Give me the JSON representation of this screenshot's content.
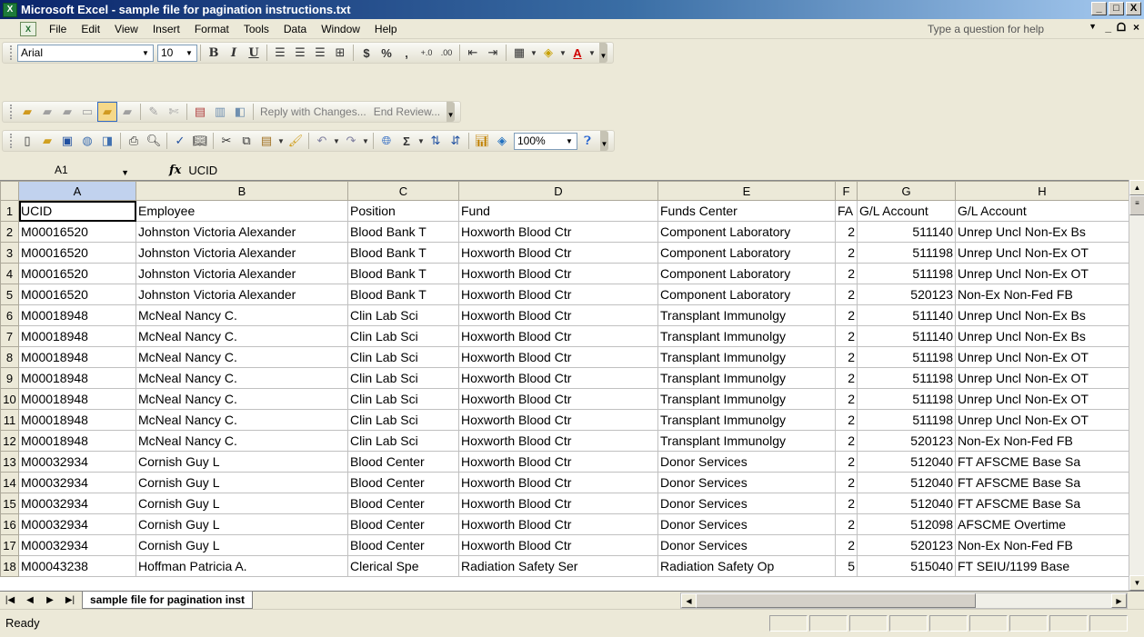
{
  "window": {
    "title": "Microsoft Excel - sample file for pagination instructions.txt",
    "min": "_",
    "max": "□",
    "close": "X",
    "app_icon": "X"
  },
  "menu": {
    "doc_icon": "X",
    "items": [
      "File",
      "Edit",
      "View",
      "Insert",
      "Format",
      "Tools",
      "Data",
      "Window",
      "Help"
    ],
    "help_placeholder": "Type a question for help",
    "doc_min": "_",
    "doc_restore": "ᗝ",
    "doc_close": "×"
  },
  "formatting_toolbar": {
    "font": "Arial",
    "size": "10",
    "bold": "B",
    "italic": "I",
    "underline": "U",
    "currency": "$",
    "percent": "%",
    "comma": ",",
    "inc_decimal": "+.0",
    "dec_decimal": ".00",
    "font_color": "A"
  },
  "reviewing_toolbar": {
    "reply": "Reply with Changes...",
    "end_review": "End Review..."
  },
  "standard_toolbar": {
    "autosum": "Σ",
    "zoom": "100%"
  },
  "formula_bar": {
    "name_box": "A1",
    "fx": "fx",
    "value": "UCID"
  },
  "sheet": {
    "columns": [
      "A",
      "B",
      "C",
      "D",
      "E",
      "F",
      "G",
      "H"
    ],
    "rows": [
      [
        "UCID",
        "Employee",
        "Position",
        "Fund",
        "Funds Center",
        "FA",
        "G/L Account",
        "G/L Account"
      ],
      [
        "M00016520",
        "Johnston Victoria Alexander",
        "Blood Bank T",
        "Hoxworth Blood Ctr",
        "Component Laboratory",
        "2",
        "511140",
        "Unrep Uncl Non-Ex Bs"
      ],
      [
        "M00016520",
        "Johnston Victoria Alexander",
        "Blood Bank T",
        "Hoxworth Blood Ctr",
        "Component Laboratory",
        "2",
        "511198",
        "Unrep Uncl Non-Ex OT"
      ],
      [
        "M00016520",
        "Johnston Victoria Alexander",
        "Blood Bank T",
        "Hoxworth Blood Ctr",
        "Component Laboratory",
        "2",
        "511198",
        "Unrep Uncl Non-Ex OT"
      ],
      [
        "M00016520",
        "Johnston Victoria Alexander",
        "Blood Bank T",
        "Hoxworth Blood Ctr",
        "Component Laboratory",
        "2",
        "520123",
        "Non-Ex Non-Fed FB"
      ],
      [
        "M00018948",
        "McNeal Nancy C.",
        "Clin Lab Sci",
        "Hoxworth Blood Ctr",
        "Transplant Immunolgy",
        "2",
        "511140",
        "Unrep Uncl Non-Ex Bs"
      ],
      [
        "M00018948",
        "McNeal Nancy C.",
        "Clin Lab Sci",
        "Hoxworth Blood Ctr",
        "Transplant Immunolgy",
        "2",
        "511140",
        "Unrep Uncl Non-Ex Bs"
      ],
      [
        "M00018948",
        "McNeal Nancy C.",
        "Clin Lab Sci",
        "Hoxworth Blood Ctr",
        "Transplant Immunolgy",
        "2",
        "511198",
        "Unrep Uncl Non-Ex OT"
      ],
      [
        "M00018948",
        "McNeal Nancy C.",
        "Clin Lab Sci",
        "Hoxworth Blood Ctr",
        "Transplant Immunolgy",
        "2",
        "511198",
        "Unrep Uncl Non-Ex OT"
      ],
      [
        "M00018948",
        "McNeal Nancy C.",
        "Clin Lab Sci",
        "Hoxworth Blood Ctr",
        "Transplant Immunolgy",
        "2",
        "511198",
        "Unrep Uncl Non-Ex OT"
      ],
      [
        "M00018948",
        "McNeal Nancy C.",
        "Clin Lab Sci",
        "Hoxworth Blood Ctr",
        "Transplant Immunolgy",
        "2",
        "511198",
        "Unrep Uncl Non-Ex OT"
      ],
      [
        "M00018948",
        "McNeal Nancy C.",
        "Clin Lab Sci",
        "Hoxworth Blood Ctr",
        "Transplant Immunolgy",
        "2",
        "520123",
        "Non-Ex Non-Fed FB"
      ],
      [
        "M00032934",
        "Cornish Guy L",
        "Blood Center",
        "Hoxworth Blood Ctr",
        "Donor Services",
        "2",
        "512040",
        "FT AFSCME Base Sa"
      ],
      [
        "M00032934",
        "Cornish Guy L",
        "Blood Center",
        "Hoxworth Blood Ctr",
        "Donor Services",
        "2",
        "512040",
        "FT AFSCME Base Sa"
      ],
      [
        "M00032934",
        "Cornish Guy L",
        "Blood Center",
        "Hoxworth Blood Ctr",
        "Donor Services",
        "2",
        "512040",
        "FT AFSCME Base Sa"
      ],
      [
        "M00032934",
        "Cornish Guy L",
        "Blood Center",
        "Hoxworth Blood Ctr",
        "Donor Services",
        "2",
        "512098",
        "AFSCME Overtime"
      ],
      [
        "M00032934",
        "Cornish Guy L",
        "Blood Center",
        "Hoxworth Blood Ctr",
        "Donor Services",
        "2",
        "520123",
        "Non-Ex Non-Fed FB"
      ],
      [
        "M00043238",
        "Hoffman Patricia A.",
        "Clerical Spe",
        "Radiation Safety Ser",
        "Radiation Safety Op",
        "5",
        "515040",
        "FT SEIU/1199 Base"
      ]
    ]
  },
  "tabs": {
    "sheet_name": "sample file for pagination inst"
  },
  "status": {
    "text": "Ready"
  }
}
